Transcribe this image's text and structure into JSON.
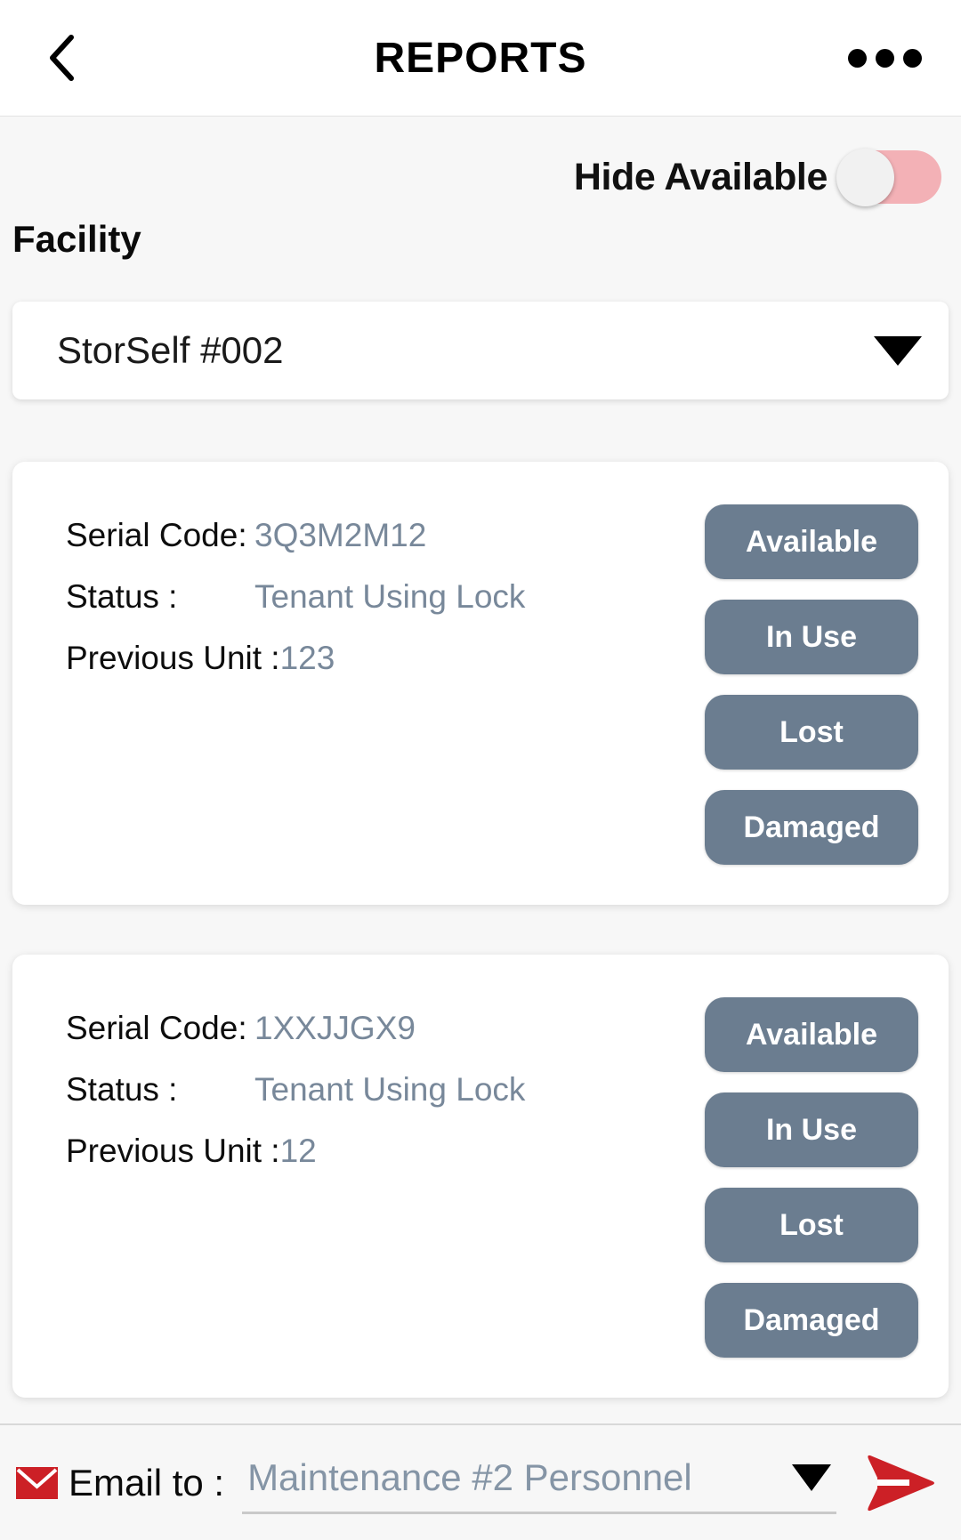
{
  "header": {
    "title": "REPORTS",
    "back_icon": "chevron-left-icon",
    "more_icon": "more-horizontal-icon"
  },
  "filter": {
    "hide_available_label": "Hide Available",
    "hide_available_on": false
  },
  "facility": {
    "label": "Facility",
    "selected": "StorSelf #002",
    "caret_icon": "chevron-down-icon"
  },
  "labels": {
    "serial_code": "Serial Code:",
    "status": "Status :",
    "previous_unit": "Previous Unit :"
  },
  "actions": [
    "Available",
    "In Use",
    "Lost",
    "Damaged"
  ],
  "locks": [
    {
      "serial_code": "3Q3M2M12",
      "status": "Tenant Using Lock",
      "previous_unit": "123"
    },
    {
      "serial_code": "1XXJJGX9",
      "status": "Tenant Using Lock",
      "previous_unit": "12"
    }
  ],
  "email_bar": {
    "envelope_icon": "envelope-icon",
    "label": "Email to :",
    "selected_recipient": "Maintenance #2 Personnel",
    "caret_icon": "chevron-down-icon",
    "send_icon": "send-arrow-icon"
  },
  "colors": {
    "action_button": "#6b7d90",
    "value_text": "#78889a",
    "toggle_track": "#f3b1b6",
    "accent_red": "#cc2026"
  }
}
